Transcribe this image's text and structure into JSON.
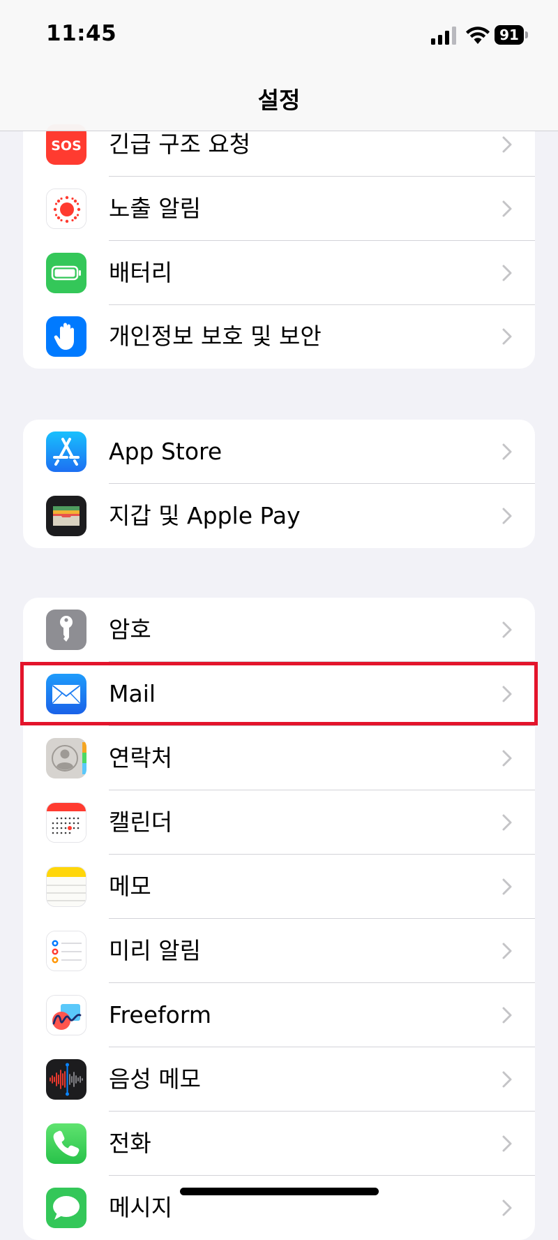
{
  "status": {
    "time": "11:45",
    "battery": "91"
  },
  "nav": {
    "title": "설정"
  },
  "group1": [
    {
      "label": "긴급 구조 요청",
      "icon": "sos-icon",
      "color": "#ff3b30"
    },
    {
      "label": "노출 알림",
      "icon": "exposure-notification-icon",
      "color": "#ffffff"
    },
    {
      "label": "배터리",
      "icon": "battery-icon",
      "color": "#34c759"
    },
    {
      "label": "개인정보 보호 및 보안",
      "icon": "privacy-hand-icon",
      "color": "#007aff"
    }
  ],
  "group2": [
    {
      "label": "App Store",
      "icon": "app-store-icon",
      "color": "#1e8ef7"
    },
    {
      "label": "지갑 및 Apple Pay",
      "icon": "wallet-icon",
      "color": "#1c1c1e"
    }
  ],
  "group3": [
    {
      "label": "암호",
      "icon": "key-icon",
      "color": "#8e8e93"
    },
    {
      "label": "Mail",
      "icon": "mail-icon",
      "color": "#1e88f5"
    },
    {
      "label": "연락처",
      "icon": "contacts-icon",
      "color": "#d6d3cf"
    },
    {
      "label": "캘린더",
      "icon": "calendar-icon",
      "color": "#ffffff"
    },
    {
      "label": "메모",
      "icon": "notes-icon",
      "color": "#ffd60a"
    },
    {
      "label": "미리 알림",
      "icon": "reminders-icon",
      "color": "#ffffff"
    },
    {
      "label": "Freeform",
      "icon": "freeform-icon",
      "color": "#ffffff"
    },
    {
      "label": "음성 메모",
      "icon": "voice-memos-icon",
      "color": "#1c1c1e"
    },
    {
      "label": "전화",
      "icon": "phone-icon",
      "color": "#34c759"
    },
    {
      "label": "메시지",
      "icon": "messages-icon",
      "color": "#34c759"
    }
  ],
  "highlight_color": "#e3142b"
}
